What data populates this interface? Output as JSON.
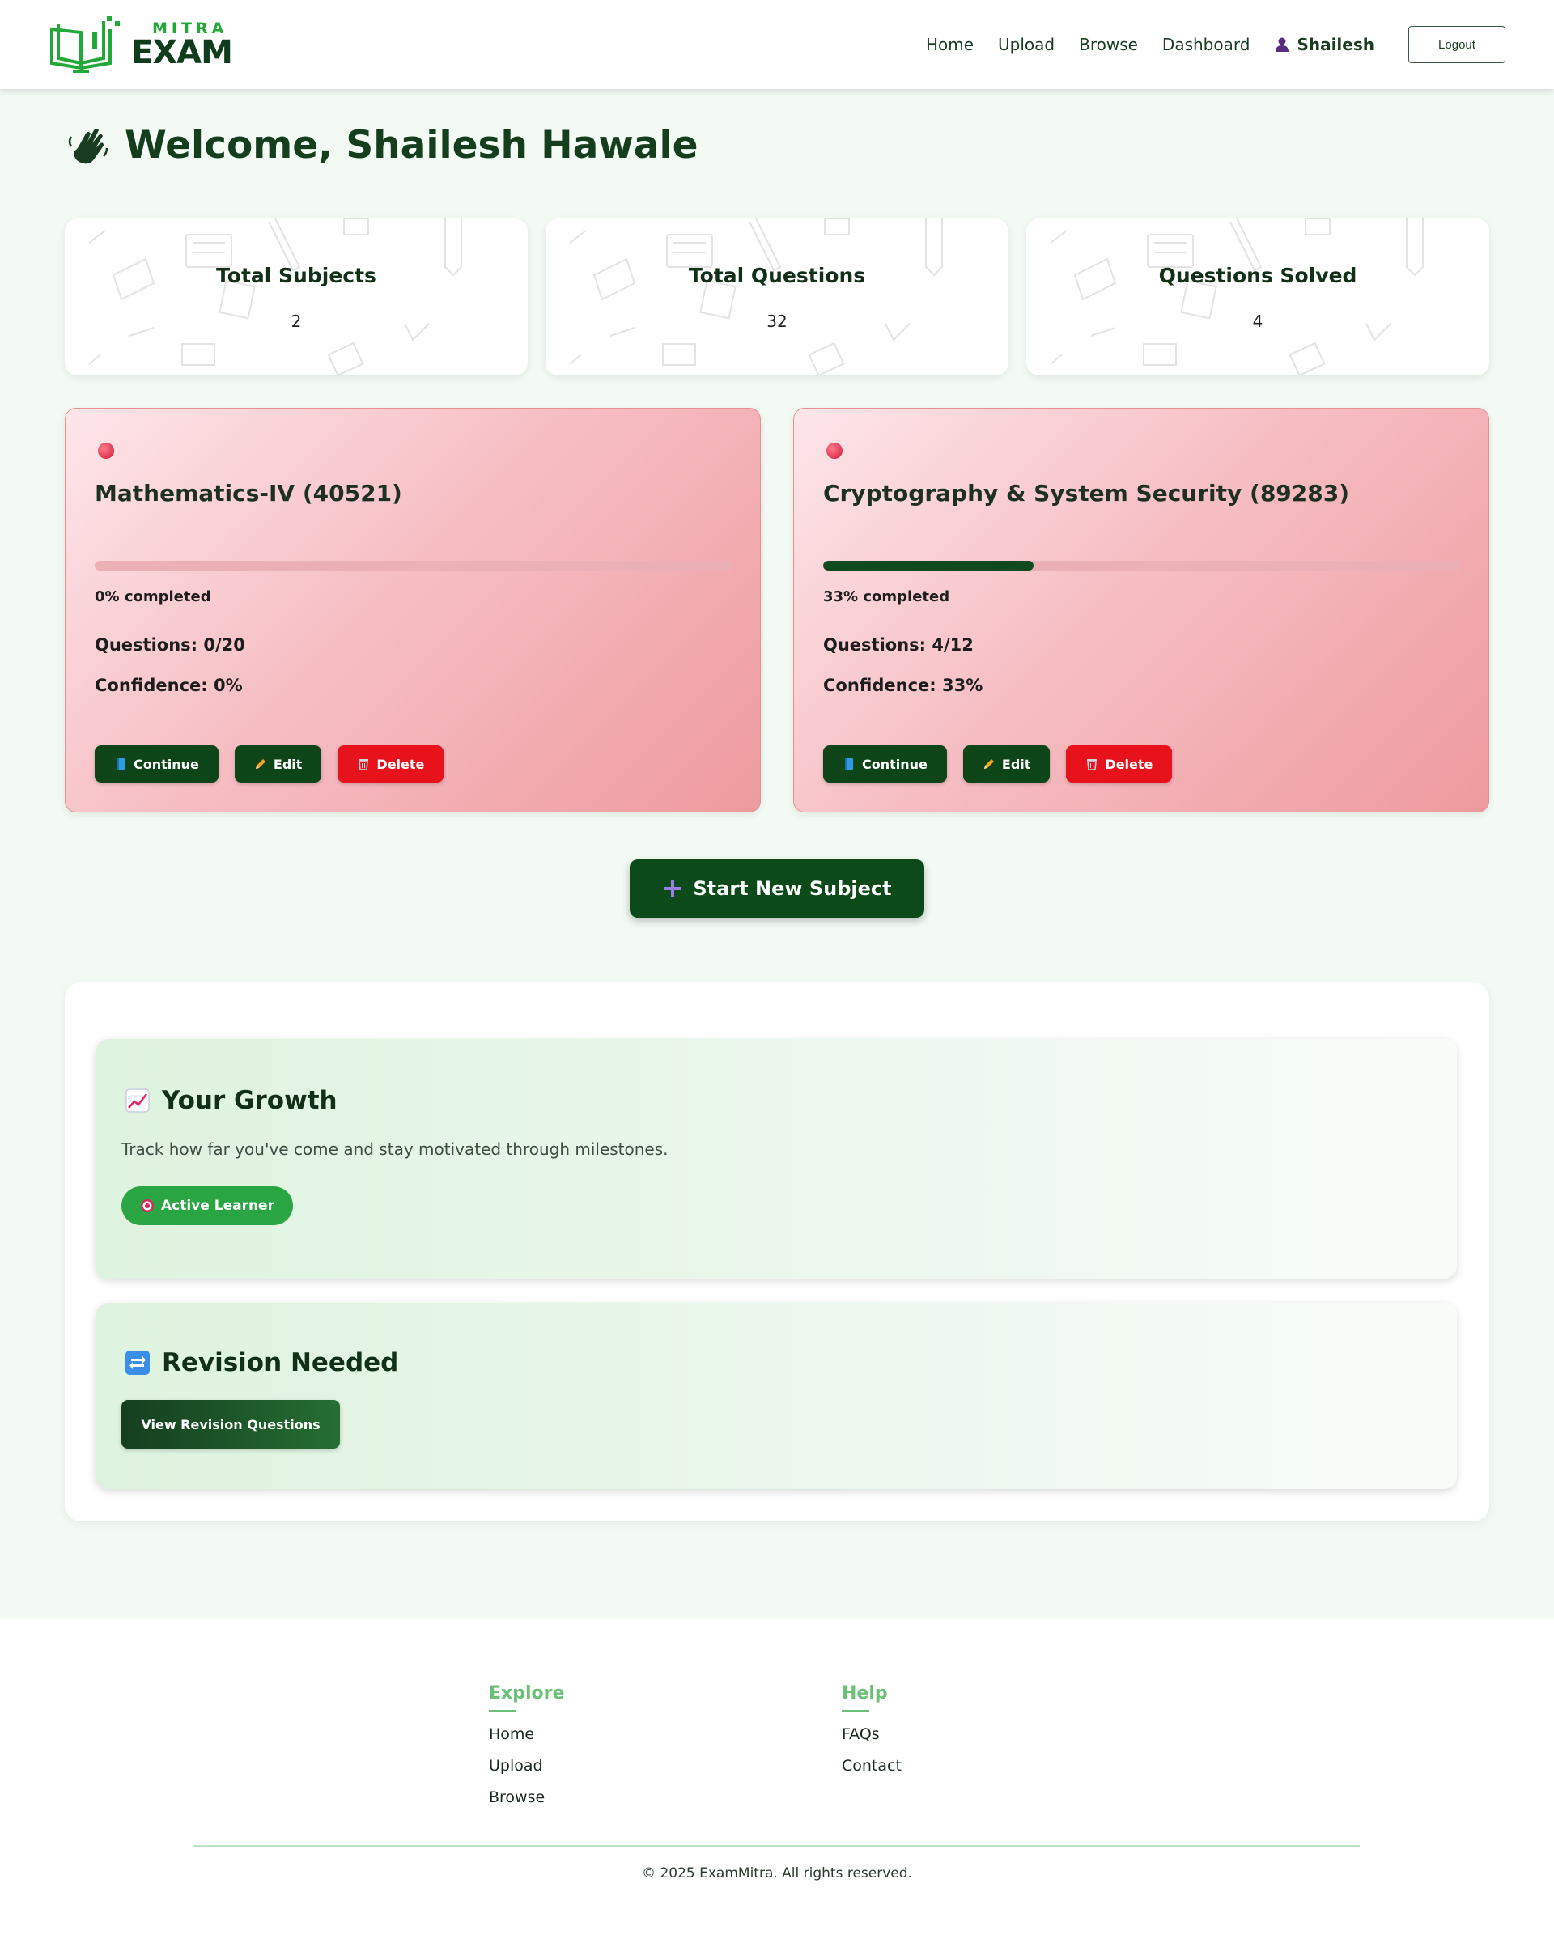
{
  "brand": {
    "top": "MITRA",
    "bottom": "EXAM",
    "accent": "#22a839",
    "dark": "#0f3d1c"
  },
  "nav": {
    "links": [
      "Home",
      "Upload",
      "Browse",
      "Dashboard"
    ],
    "user": "Shailesh",
    "user_icon": "user-icon",
    "logout": "Logout"
  },
  "welcome": {
    "icon": "waving-hand-icon",
    "text": "Welcome, Shailesh Hawale"
  },
  "stats": [
    {
      "label": "Total Subjects",
      "value": "2"
    },
    {
      "label": "Total Questions",
      "value": "32"
    },
    {
      "label": "Questions Solved",
      "value": "4"
    }
  ],
  "subjects": [
    {
      "title": "Mathematics-IV (40521)",
      "progress": 0,
      "percent_text": "0% completed",
      "questions": "Questions: 0/20",
      "confidence": "Confidence: 0%",
      "actions": {
        "continue": "Continue",
        "edit": "Edit",
        "delete": "Delete"
      }
    },
    {
      "title": "Cryptography & System Security (89283)",
      "progress": 33,
      "percent_text": "33% completed",
      "questions": "Questions: 4/12",
      "confidence": "Confidence: 33%",
      "actions": {
        "continue": "Continue",
        "edit": "Edit",
        "delete": "Delete"
      }
    }
  ],
  "start_new": {
    "icon": "plus-icon",
    "label": "Start New Subject"
  },
  "growth": {
    "icon": "chart-increasing-icon",
    "title": "Your Growth",
    "text": "Track how far you've come and stay motivated through milestones.",
    "badge_icon": "target-icon",
    "badge": "Active Learner"
  },
  "revision": {
    "icon": "repeat-icon",
    "title": "Revision Needed",
    "button": "View Revision Questions"
  },
  "footer": {
    "explore": {
      "heading": "Explore",
      "links": [
        "Home",
        "Upload",
        "Browse"
      ]
    },
    "help": {
      "heading": "Help",
      "links": [
        "FAQs",
        "Contact"
      ]
    },
    "copyright": "© 2025 ExamMitra. All rights reserved."
  },
  "colors": {
    "background": "#f2faf3",
    "primary_green": "#0d4418",
    "danger_red": "#e8121d",
    "card_pink": "#f6bfc4",
    "badge_green": "#2aa544"
  }
}
